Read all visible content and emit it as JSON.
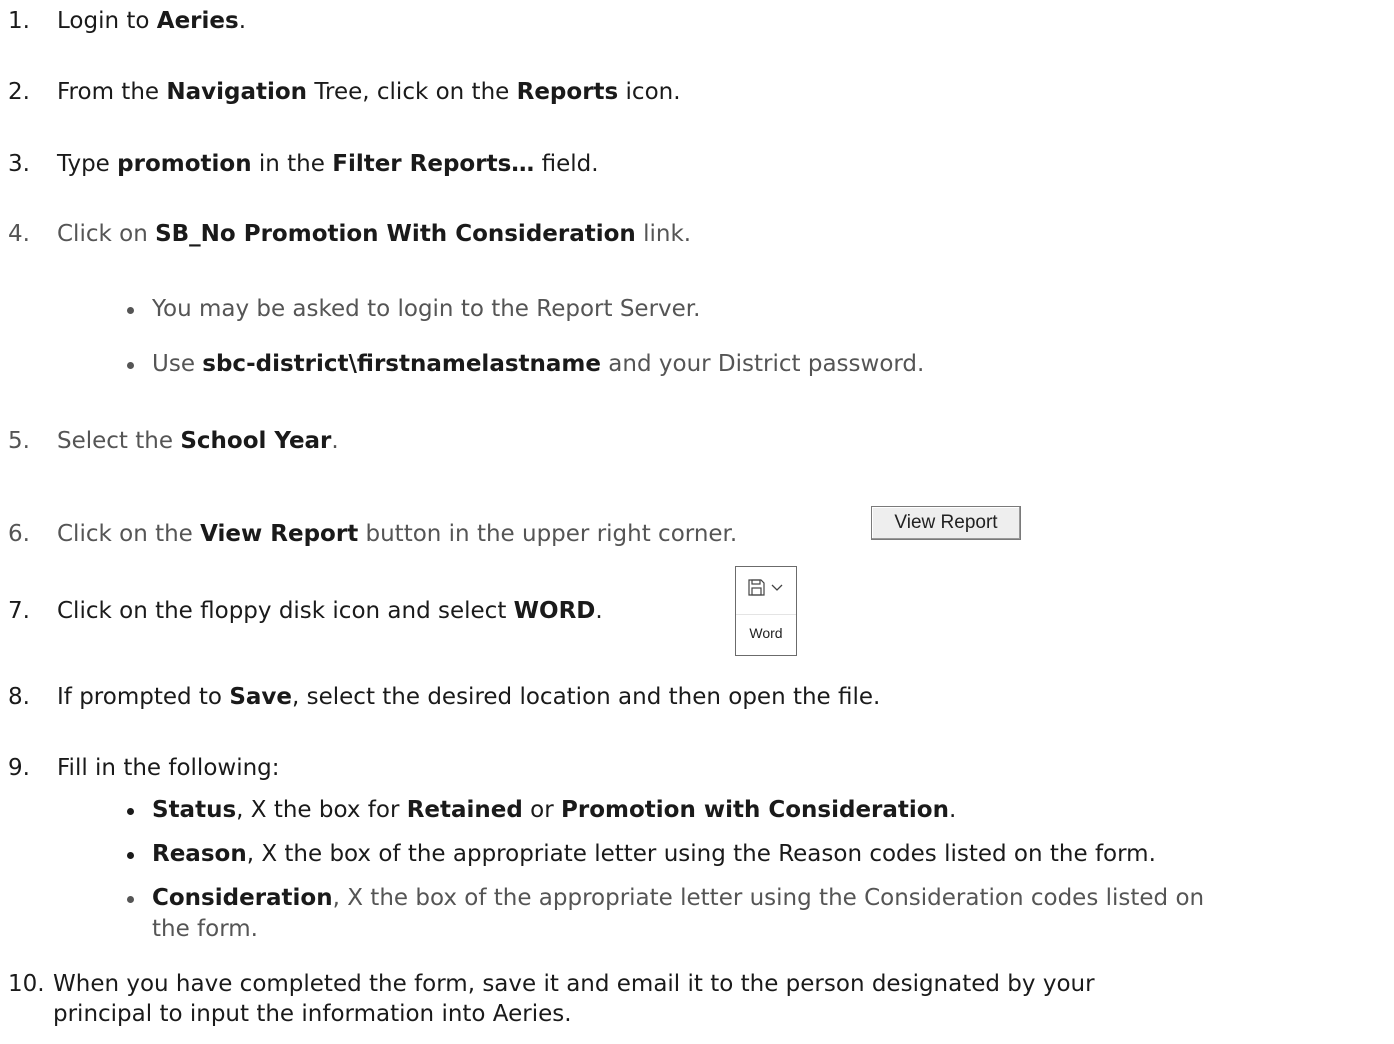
{
  "steps": [
    {
      "num": "1.",
      "parts": [
        {
          "t": "Login to "
        },
        {
          "t": "Aeries",
          "b": true
        },
        {
          "t": "."
        }
      ]
    },
    {
      "num": "2.",
      "parts": [
        {
          "t": "From the "
        },
        {
          "t": "Navigation",
          "b": true
        },
        {
          "t": " Tree, click on the "
        },
        {
          "t": "Reports",
          "b": true
        },
        {
          "t": " icon."
        }
      ]
    },
    {
      "num": "3.",
      "parts": [
        {
          "t": "Type "
        },
        {
          "t": "promotion",
          "b": true
        },
        {
          "t": " in the "
        },
        {
          "t": "Filter Reports…",
          "b": true
        },
        {
          "t": " field."
        }
      ]
    },
    {
      "num": "4.",
      "parts": [
        {
          "t": "Click on "
        },
        {
          "t": "SB_No Promotion With Consideration",
          "b": true
        },
        {
          "t": " link."
        }
      ]
    },
    {
      "num": "5.",
      "parts": [
        {
          "t": "Select the "
        },
        {
          "t": "School Year",
          "b": true
        },
        {
          "t": "."
        }
      ]
    },
    {
      "num": "6.",
      "parts": [
        {
          "t": "Click on the "
        },
        {
          "t": "View Report",
          "b": true
        },
        {
          "t": "  button in the upper right corner."
        }
      ]
    },
    {
      "num": "7.",
      "parts": [
        {
          "t": "Click on the floppy disk icon and select "
        },
        {
          "t": "WORD",
          "b": true
        },
        {
          "t": "."
        }
      ]
    },
    {
      "num": "8.",
      "parts": [
        {
          "t": "If prompted to "
        },
        {
          "t": "Save",
          "b": true
        },
        {
          "t": ", select the desired location and then open the file."
        }
      ]
    },
    {
      "num": "9.",
      "parts": [
        {
          "t": "Fill in the following:"
        }
      ]
    },
    {
      "num": "10.",
      "parts": [
        {
          "t": "When you have completed the form, save it and email it to the person designated by your"
        }
      ]
    }
  ],
  "step10_continuation": "principal to input the information into Aeries.",
  "step4_bullets": [
    {
      "parts": [
        {
          "t": "You may be asked to login to the Report Server."
        }
      ]
    },
    {
      "parts": [
        {
          "t": "Use "
        },
        {
          "t": "sbc-district\\firstnamelastname",
          "b": true
        },
        {
          "t": " and your District password."
        }
      ]
    }
  ],
  "step9_bullets": [
    {
      "parts": [
        {
          "t": "Status",
          "b": true
        },
        {
          "t": ", X the box for "
        },
        {
          "t": "Retained",
          "b": true
        },
        {
          "t": " or "
        },
        {
          "t": "Promotion with Consideration",
          "b": true
        },
        {
          "t": "."
        }
      ]
    },
    {
      "parts": [
        {
          "t": "Reason",
          "b": true
        },
        {
          "t": ", X the box of the appropriate letter using the Reason codes listed on the form."
        }
      ]
    },
    {
      "parts": [
        {
          "t": "Consideration",
          "b": true
        },
        {
          "t": ", X the box of the appropriate letter using the Consideration codes listed on"
        }
      ]
    }
  ],
  "step9_bullet3_continuation": "the form.",
  "view_report_button": "View Report",
  "word_export": {
    "icon": "floppy-disk-icon",
    "label": "Word"
  },
  "colors": {
    "text_dark": "#1a1a1a",
    "text_gray": "#555555"
  }
}
